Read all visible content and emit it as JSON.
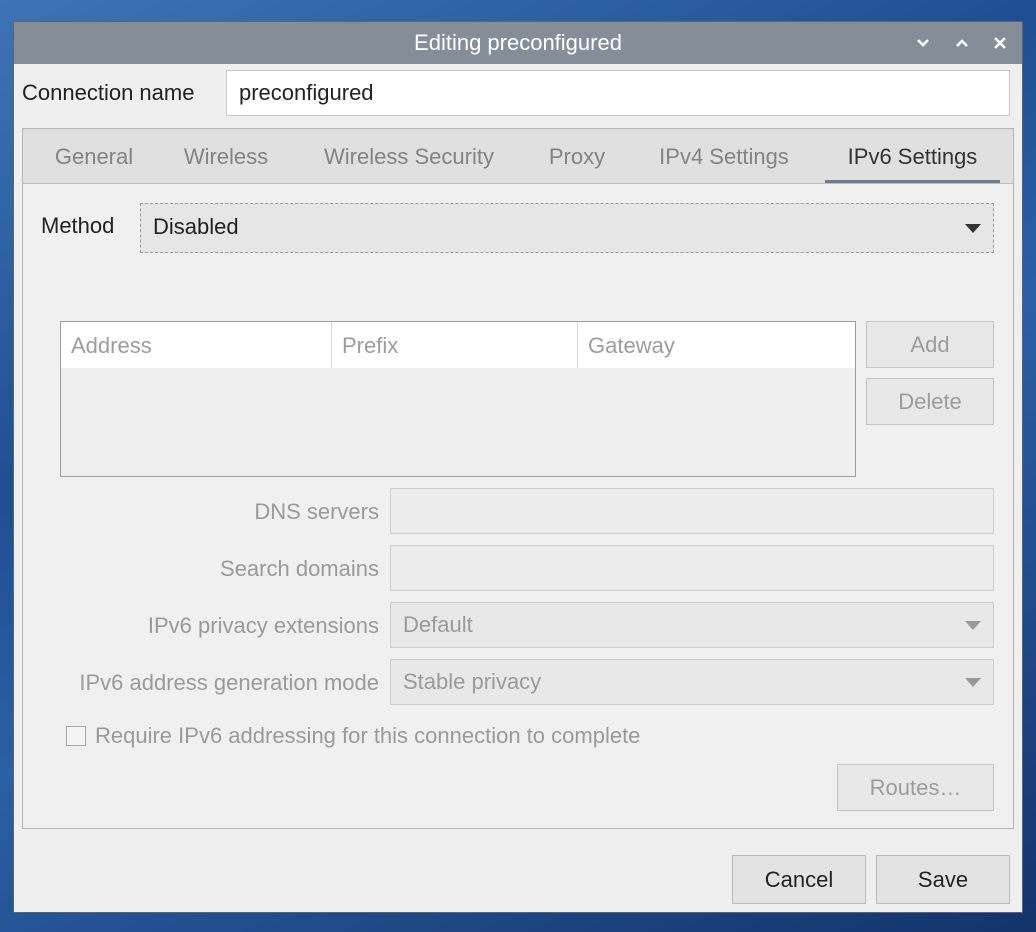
{
  "window": {
    "title": "Editing preconfigured"
  },
  "connection": {
    "label": "Connection name",
    "value": "preconfigured"
  },
  "tabs": [
    {
      "label": "General"
    },
    {
      "label": "Wireless"
    },
    {
      "label": "Wireless Security"
    },
    {
      "label": "Proxy"
    },
    {
      "label": "IPv4 Settings"
    },
    {
      "label": "IPv6 Settings",
      "active": true
    }
  ],
  "ipv6": {
    "method_label": "Method",
    "method_value": "Disabled",
    "address_columns": [
      "Address",
      "Prefix",
      "Gateway"
    ],
    "add_label": "Add",
    "delete_label": "Delete",
    "dns_label": "DNS servers",
    "dns_value": "",
    "search_label": "Search domains",
    "search_value": "",
    "privacy_label": "IPv6 privacy extensions",
    "privacy_value": "Default",
    "addrgen_label": "IPv6 address generation mode",
    "addrgen_value": "Stable privacy",
    "require_label": "Require IPv6 addressing for this connection to complete",
    "require_checked": false,
    "routes_label": "Routes…"
  },
  "footer": {
    "cancel_label": "Cancel",
    "save_label": "Save"
  },
  "icons": {
    "minimize": "chevron-down-icon",
    "maximize": "chevron-up-icon",
    "close": "close-icon",
    "dropdown": "caret-down-icon"
  },
  "colors": {
    "titlebar": "#858d99",
    "window_bg": "#efefef",
    "active_tab_indicator": "#6c7a8e",
    "disabled_text": "#9a9a9a"
  }
}
